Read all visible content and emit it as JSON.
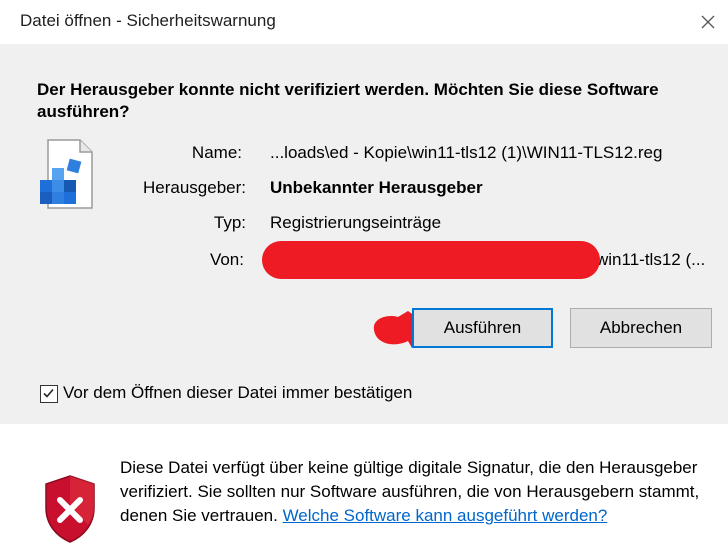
{
  "window": {
    "title": "Datei öffnen - Sicherheitswarnung"
  },
  "heading": "Der Herausgeber konnte nicht verifiziert werden. Möchten Sie diese Software ausführen?",
  "fields": {
    "name_label": "Name:",
    "name_value": "...loads\\ed - Kopie\\win11-tls12 (1)\\WIN11-TLS12.reg",
    "publisher_label": "Herausgeber:",
    "publisher_value": "Unbekannter Herausgeber",
    "type_label": "Typ:",
    "type_value": "Registrierungseinträge",
    "from_label": "Von:",
    "from_value_visible": "win11-tls12 (..."
  },
  "buttons": {
    "run": "Ausführen",
    "cancel": "Abbrechen"
  },
  "checkbox": {
    "label": "Vor dem Öffnen dieser Datei immer bestätigen",
    "checked": true
  },
  "warning": {
    "text": "Diese Datei verfügt über keine gültige digitale Signatur, die den Herausgeber verifiziert. Sie sollten nur Software ausführen, die von Herausgebern stammt, denen Sie vertrauen. ",
    "link": "Welche Software kann ausgeführt werden?"
  },
  "icons": {
    "close": "close-icon",
    "file": "registry-file-icon",
    "shield": "security-shield-icon",
    "checkmark": "checkmark-icon"
  },
  "colors": {
    "accent": "#0078d7",
    "redaction": "#ee1a24",
    "link": "#0066cc",
    "shield_red": "#c8102e"
  }
}
